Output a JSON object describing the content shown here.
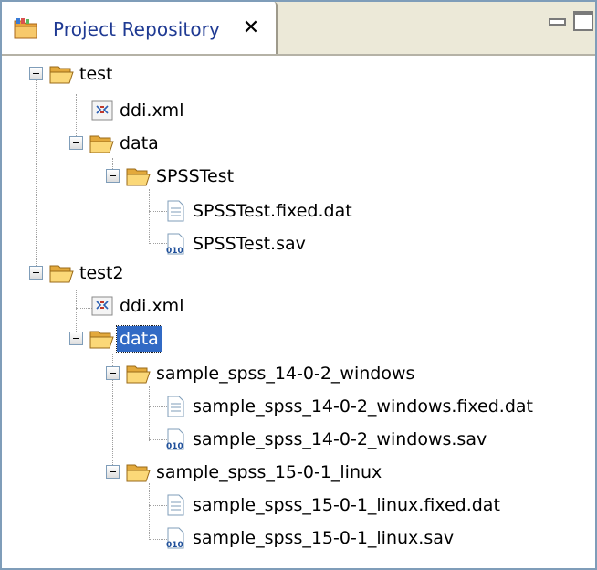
{
  "tab": {
    "title": "Project Repository",
    "close_glyph": "✕",
    "icon": "project-folder-icon"
  },
  "window_buttons": {
    "minimize": "minimize-icon",
    "maximize": "maximize-icon"
  },
  "tree": {
    "nodes": [
      {
        "label": "test",
        "icon": "folder-open-icon",
        "level": 0,
        "expanded": true
      },
      {
        "label": "ddi.xml",
        "icon": "xml-file-icon",
        "level": 1
      },
      {
        "label": "data",
        "icon": "folder-open-icon",
        "level": 1,
        "expanded": true
      },
      {
        "label": "SPSSTest",
        "icon": "folder-open-icon",
        "level": 2,
        "expanded": true
      },
      {
        "label": "SPSSTest.fixed.dat",
        "icon": "text-file-icon",
        "level": 3
      },
      {
        "label": "SPSSTest.sav",
        "icon": "binary-file-icon",
        "level": 3
      },
      {
        "label": "test2",
        "icon": "folder-open-icon",
        "level": 0,
        "expanded": true
      },
      {
        "label": "ddi.xml",
        "icon": "xml-file-icon",
        "level": 1
      },
      {
        "label": "data",
        "icon": "folder-open-icon",
        "level": 1,
        "expanded": true,
        "selected": true
      },
      {
        "label": "sample_spss_14-0-2_windows",
        "icon": "folder-open-icon",
        "level": 2,
        "expanded": true
      },
      {
        "label": "sample_spss_14-0-2_windows.fixed.dat",
        "icon": "text-file-icon",
        "level": 3
      },
      {
        "label": "sample_spss_14-0-2_windows.sav",
        "icon": "binary-file-icon",
        "level": 3
      },
      {
        "label": "sample_spss_15-0-1_linux",
        "icon": "folder-open-icon",
        "level": 2,
        "expanded": true
      },
      {
        "label": "sample_spss_15-0-1_linux.fixed.dat",
        "icon": "text-file-icon",
        "level": 3
      },
      {
        "label": "sample_spss_15-0-1_linux.sav",
        "icon": "binary-file-icon",
        "level": 3
      }
    ]
  },
  "binary_icon_text": "010"
}
